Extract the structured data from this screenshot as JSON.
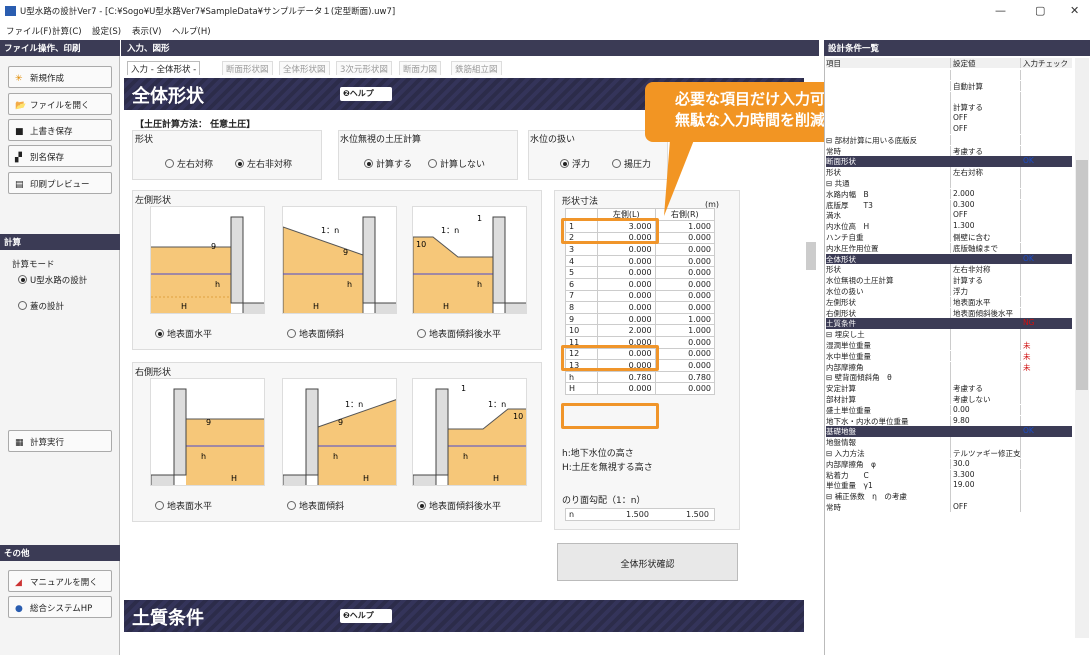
{
  "window": {
    "title": "U型水路の設計Ver7 - [C:¥Sogo¥U型水路Ver7¥SampleData¥サンプルデータ１(定型断面).uw7]",
    "minimize": "—",
    "maximize": "▢",
    "close": "✕"
  },
  "menu": [
    "ファイル(F)",
    "計算(C)",
    "設定(S)",
    "表示(V)",
    "ヘルプ(H)"
  ],
  "left": {
    "file_header": "ファイル操作、印刷",
    "buttons": [
      {
        "label": "新規作成",
        "icon": "✳"
      },
      {
        "label": "ファイルを開く",
        "icon": "📂"
      },
      {
        "label": "上書き保存",
        "icon": "■"
      },
      {
        "label": "別名保存",
        "icon": "▞"
      },
      {
        "label": "印刷プレビュー",
        "icon": "▤"
      }
    ],
    "calc_header": "計算",
    "calc_mode_label": "計算モード",
    "calc_modes": [
      {
        "label": "U型水路の設計",
        "checked": true
      },
      {
        "label": "蓋の設計",
        "checked": false
      }
    ],
    "run_button": "計算実行",
    "other_header": "その他",
    "manual_button": "マニュアルを開く",
    "hp_button": "総合システムHP"
  },
  "center": {
    "header": "入力、図形",
    "tabs": [
      "入力 - 全体形状 -",
      "断面形状図",
      "全体形状図",
      "3次元形状図",
      "断面力図",
      "鉄筋組立図"
    ],
    "section_title": "全体形状",
    "help_label": "ヘルプ",
    "earth_method": "【土圧計算方法： 任意土圧】",
    "shape": {
      "label": "形状",
      "options": [
        {
          "label": "左右対称",
          "checked": false
        },
        {
          "label": "左右非対称",
          "checked": true
        }
      ]
    },
    "water_ignore": {
      "label": "水位無視の土圧計算",
      "options": [
        {
          "label": "計算する",
          "checked": true
        },
        {
          "label": "計算しない",
          "checked": false
        }
      ]
    },
    "water_handling": {
      "label": "水位の扱い",
      "options": [
        {
          "label": "浮力",
          "checked": true
        },
        {
          "label": "揚圧力",
          "checked": false
        }
      ]
    },
    "left_shape": {
      "label": "左側形状",
      "options": [
        {
          "label": "地表面水平",
          "checked": true
        },
        {
          "label": "地表面傾斜",
          "checked": false
        },
        {
          "label": "地表面傾斜後水平",
          "checked": false
        }
      ]
    },
    "right_shape": {
      "label": "右側形状",
      "options": [
        {
          "label": "地表面水平",
          "checked": false
        },
        {
          "label": "地表面傾斜",
          "checked": false
        },
        {
          "label": "地表面傾斜後水平",
          "checked": true
        }
      ]
    },
    "diagram_labels": {
      "slope": "1：n",
      "nine": "9",
      "ten": "10",
      "one": "1",
      "h": "h",
      "H": "H"
    },
    "dims": {
      "label": "形状寸法",
      "unit": "(m)",
      "col_left": "左側(L)",
      "col_right": "右側(R)",
      "rows": [
        [
          "1",
          "3.000",
          "1.000"
        ],
        [
          "2",
          "0.000",
          "0.000"
        ],
        [
          "3",
          "0.000",
          "0.000"
        ],
        [
          "4",
          "0.000",
          "0.000"
        ],
        [
          "5",
          "0.000",
          "0.000"
        ],
        [
          "6",
          "0.000",
          "0.000"
        ],
        [
          "7",
          "0.000",
          "0.000"
        ],
        [
          "8",
          "0.000",
          "0.000"
        ],
        [
          "9",
          "0.000",
          "1.000"
        ],
        [
          "10",
          "2.000",
          "1.000"
        ],
        [
          "11",
          "0.000",
          "0.000"
        ],
        [
          "12",
          "0.000",
          "0.000"
        ],
        [
          "13",
          "0.000",
          "0.000"
        ],
        [
          "h",
          "0.780",
          "0.780"
        ],
        [
          "H",
          "0.000",
          "0.000"
        ]
      ]
    },
    "note1": "h:地下水位の高さ",
    "note2": "H:土圧を無視する高さ",
    "slope_label": "のり面勾配（1：n）",
    "slope_row": [
      "n",
      "1.500",
      "1.500"
    ],
    "confirm_button": "全体形状確認",
    "next_section": "土質条件",
    "callout": [
      "必要な項目だけ入力可能。",
      "無駄な入力時間を削減"
    ]
  },
  "right": {
    "header": "設計条件一覧",
    "cols": [
      "項目",
      "設定値",
      "入力チェック"
    ],
    "rows": [
      {
        "t": "row",
        "c": [
          "",
          "",
          ""
        ]
      },
      {
        "t": "row",
        "c": [
          "",
          "自動計算",
          ""
        ]
      },
      {
        "t": "row",
        "c": [
          "",
          "",
          ""
        ]
      },
      {
        "t": "row",
        "c": [
          "",
          "計算する",
          ""
        ]
      },
      {
        "t": "row",
        "c": [
          "",
          "OFF",
          ""
        ]
      },
      {
        "t": "row",
        "c": [
          "",
          "OFF",
          ""
        ]
      },
      {
        "t": "row",
        "c": [
          "⊟ 部材計算に用いる底版反",
          "",
          ""
        ]
      },
      {
        "t": "row",
        "c": [
          "    常時",
          "考慮する",
          ""
        ]
      },
      {
        "t": "sec",
        "c": [
          "断面形状",
          "",
          "OK"
        ]
      },
      {
        "t": "row",
        "c": [
          "  形状",
          "左右対称",
          ""
        ]
      },
      {
        "t": "row",
        "c": [
          "⊟ 共通",
          "",
          ""
        ]
      },
      {
        "t": "row",
        "c": [
          "    水路内幅　B",
          "2.000",
          ""
        ]
      },
      {
        "t": "row",
        "c": [
          "    底版厚　　T3",
          "0.300",
          ""
        ]
      },
      {
        "t": "row",
        "c": [
          "  満水",
          "OFF",
          ""
        ]
      },
      {
        "t": "row",
        "c": [
          "  内水位高　H",
          "1.300",
          ""
        ]
      },
      {
        "t": "row",
        "c": [
          "  ハンチ自重",
          "側壁に含む",
          ""
        ]
      },
      {
        "t": "row",
        "c": [
          "  内水圧作用位置",
          "底版軸線まで",
          ""
        ]
      },
      {
        "t": "sec",
        "c": [
          "全体形状",
          "",
          "OK"
        ]
      },
      {
        "t": "row",
        "c": [
          "  形状",
          "左右非対称",
          ""
        ]
      },
      {
        "t": "row",
        "c": [
          "  水位無視の土圧計算",
          "計算する",
          ""
        ]
      },
      {
        "t": "row",
        "c": [
          "  水位の扱い",
          "浮力",
          ""
        ]
      },
      {
        "t": "row",
        "c": [
          "  左側形状",
          "地表面水平",
          ""
        ]
      },
      {
        "t": "row",
        "c": [
          "  右側形状",
          "地表面傾斜後水平",
          ""
        ]
      },
      {
        "t": "sec",
        "c": [
          "土質条件",
          "",
          "NG"
        ]
      },
      {
        "t": "row",
        "c": [
          "⊟ 埋戻し土",
          "",
          ""
        ]
      },
      {
        "t": "row",
        "c": [
          "    湿潤単位重量",
          "",
          "未"
        ]
      },
      {
        "t": "row",
        "c": [
          "    水中単位重量",
          "",
          "未"
        ]
      },
      {
        "t": "row",
        "c": [
          "    内部摩擦角",
          "",
          "未"
        ]
      },
      {
        "t": "row",
        "c": [
          "⊟ 壁背面傾斜角　θ",
          "",
          ""
        ]
      },
      {
        "t": "row",
        "c": [
          "    安定計算",
          "考慮する",
          ""
        ]
      },
      {
        "t": "row",
        "c": [
          "    部材計算",
          "考慮しない",
          ""
        ]
      },
      {
        "t": "row",
        "c": [
          "  盛土単位重量",
          "0.00",
          ""
        ]
      },
      {
        "t": "row",
        "c": [
          "  地下水・内水の単位重量",
          "9.80",
          ""
        ]
      },
      {
        "t": "sec",
        "c": [
          "基礎地盤",
          "",
          "OK"
        ]
      },
      {
        "t": "row",
        "c": [
          "  地盤情報",
          "",
          ""
        ]
      },
      {
        "t": "row",
        "c": [
          "⊟ 入力方法",
          "テルツァギー修正支",
          ""
        ]
      },
      {
        "t": "row",
        "c": [
          "    内部摩擦角　φ",
          "30.0",
          ""
        ]
      },
      {
        "t": "row",
        "c": [
          "    粘着力　　C",
          "3.300",
          ""
        ]
      },
      {
        "t": "row",
        "c": [
          "    単位重量　γ1",
          "19.00",
          ""
        ]
      },
      {
        "t": "row",
        "c": [
          "⊟ 補正係数　η　の考慮",
          "",
          ""
        ]
      },
      {
        "t": "row",
        "c": [
          "    常時",
          "OFF",
          ""
        ]
      }
    ]
  }
}
